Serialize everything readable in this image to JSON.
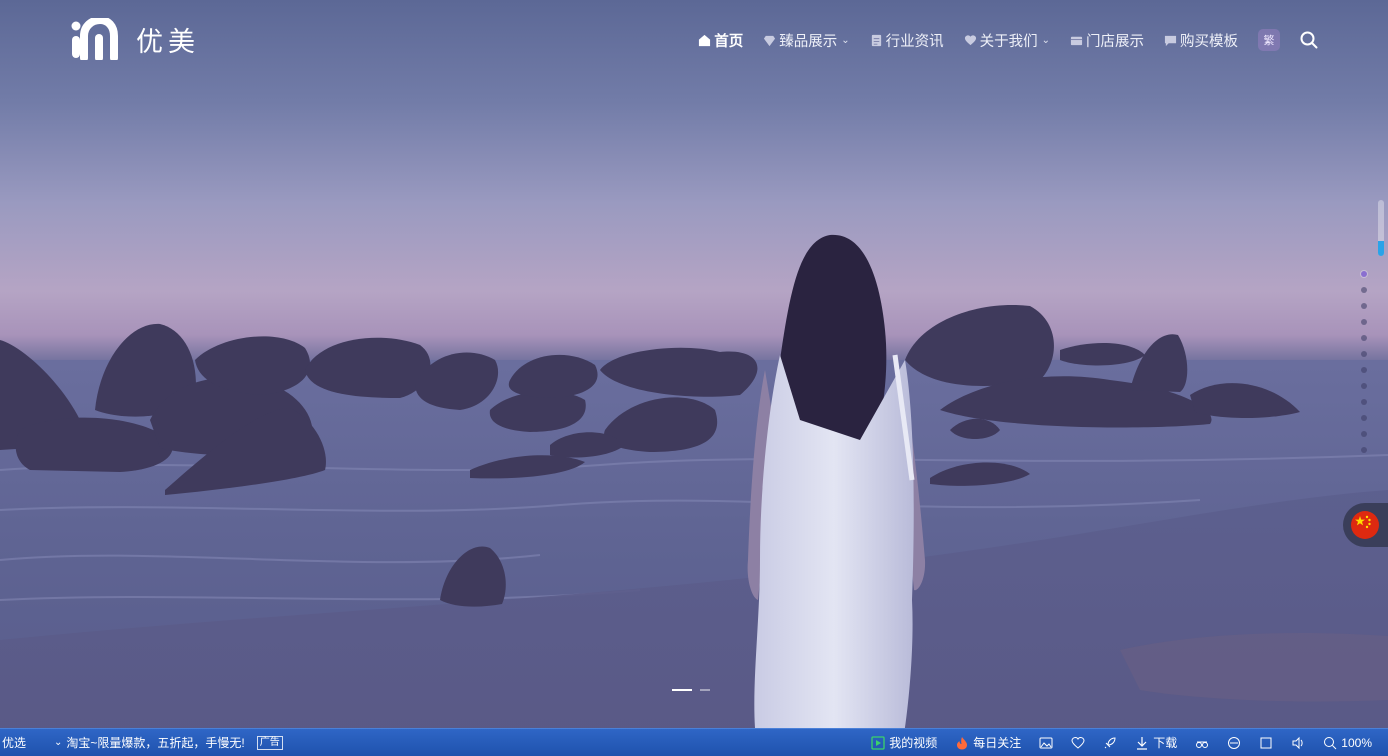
{
  "brand": {
    "name": "优美"
  },
  "nav": {
    "items": [
      {
        "label": "首页",
        "icon": "home-icon",
        "active": true,
        "dropdown": false
      },
      {
        "label": "臻品展示",
        "icon": "diamond-icon",
        "active": false,
        "dropdown": true
      },
      {
        "label": "行业资讯",
        "icon": "document-icon",
        "active": false,
        "dropdown": false
      },
      {
        "label": "关于我们",
        "icon": "heart-icon",
        "active": false,
        "dropdown": true
      },
      {
        "label": "门店展示",
        "icon": "store-icon",
        "active": false,
        "dropdown": false
      },
      {
        "label": "购买模板",
        "icon": "message-icon",
        "active": false,
        "dropdown": false
      }
    ],
    "lang_toggle": "繁"
  },
  "slider": {
    "total": 2,
    "current": 1
  },
  "side_dots": {
    "total": 12,
    "active": 1
  },
  "taskbar": {
    "left_label": "优选",
    "news_text": "淘宝~限量爆款，五折起，手慢无!",
    "news_tag": "广告",
    "items": [
      {
        "label": "我的视频",
        "icon": "video-play-icon"
      },
      {
        "label": "每日关注",
        "icon": "fire-icon"
      }
    ],
    "download_label": "下载",
    "zoom": "100%"
  },
  "colors": {
    "accent": "#2aa3e8",
    "taskbar": "#2a5fbf",
    "active_dot": "#8a6fd0",
    "flag_red": "#de2910"
  }
}
